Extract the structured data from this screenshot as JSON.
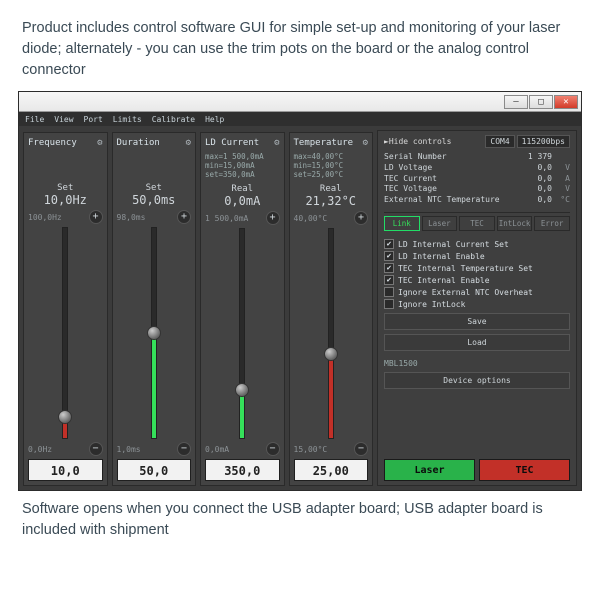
{
  "caption_top": "Product includes control software GUI for simple set-up and monitoring of your laser diode; alternately - you can use the trim pots on the board or the analog control connector",
  "caption_bottom": "Software opens when you connect the USB adapter board; USB adapter board is included with shipment",
  "window": {
    "min_label": "—",
    "max_label": "□",
    "close_label": "✕"
  },
  "menubar": [
    "File",
    "View",
    "Port",
    "Limits",
    "Calibrate",
    "Help"
  ],
  "panels": [
    {
      "title": "Frequency",
      "limits": [
        "",
        "",
        ""
      ],
      "mode_label": "Set",
      "mode_value": "10,0Hz",
      "range_top": "100,0Hz",
      "range_bot": "0,0Hz",
      "input": "10,0",
      "fill_color": "#c23028",
      "fill_pct": 10
    },
    {
      "title": "Duration",
      "limits": [
        "",
        "",
        ""
      ],
      "mode_label": "Set",
      "mode_value": "50,0ms",
      "range_top": "98,0ms",
      "range_bot": "1,0ms",
      "input": "50,0",
      "fill_color": "#35e05a",
      "fill_pct": 50
    },
    {
      "title": "LD Current",
      "limits": [
        "max=1 500,0mA",
        "min=15,00mA",
        "set=350,0mA"
      ],
      "mode_label": "Real",
      "mode_value": "0,0mA",
      "range_top": "1 500,0mA",
      "range_bot": "0,0mA",
      "input": "350,0",
      "fill_color": "#35e05a",
      "fill_pct": 23
    },
    {
      "title": "Temperature",
      "limits": [
        "max=40,00°C",
        "min=15,00°C",
        "set=25,00°C"
      ],
      "mode_label": "Real",
      "mode_value": "21,32°C",
      "range_top": "40,00°C",
      "range_bot": "15,00°C",
      "input": "25,00",
      "fill_color": "#c23028",
      "fill_pct": 40
    }
  ],
  "side": {
    "hide_label": "►Hide controls",
    "port": "COM4",
    "baud": "115200bps",
    "readouts": [
      {
        "k": "Serial Number",
        "v": "1 379",
        "u": ""
      },
      {
        "k": "LD Voltage",
        "v": "0,0",
        "u": "V"
      },
      {
        "k": "TEC Current",
        "v": "0,0",
        "u": "A"
      },
      {
        "k": "TEC Voltage",
        "v": "0,0",
        "u": "V"
      },
      {
        "k": "External NTC Temperature",
        "v": "0,0",
        "u": "°C"
      }
    ],
    "status_tabs": [
      "Link",
      "Laser",
      "TEC",
      "IntLock",
      "Error"
    ],
    "checkboxes": [
      {
        "label": "LD Internal Current Set",
        "checked": true
      },
      {
        "label": "LD Internal Enable",
        "checked": true
      },
      {
        "label": "TEC Internal Temperature Set",
        "checked": true
      },
      {
        "label": "TEC Internal Enable",
        "checked": true
      },
      {
        "label": "Ignore External NTC Overheat",
        "checked": false
      },
      {
        "label": "Ignore IntLock",
        "checked": false
      }
    ],
    "save_label": "Save",
    "load_label": "Load",
    "model": "MBL1500",
    "device_options": "Device options",
    "laser_btn": "Laser",
    "tec_btn": "TEC"
  }
}
